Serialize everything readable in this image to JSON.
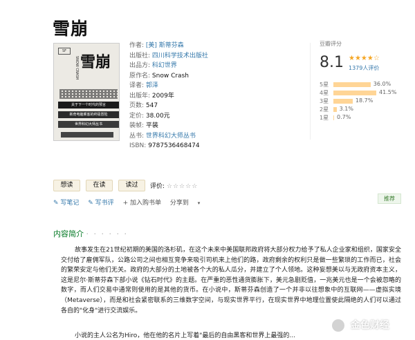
{
  "book": {
    "title": "雪崩",
    "cover": {
      "big_title": "雪崩",
      "en_title": "SNOW CRASH",
      "bands": [
        "关于下一个时代的预言",
        "新奇电脑乘客的终极冒险",
        "世界科幻大师丛书"
      ]
    },
    "info": [
      {
        "label": "作者:",
        "value": "[美] 斯蒂芬森",
        "link": true
      },
      {
        "label": "出版社:",
        "value": "四川科学技术出版社",
        "link": true
      },
      {
        "label": "出品方:",
        "value": "科幻世界",
        "link": true
      },
      {
        "label": "原作名:",
        "value": "Snow Crash",
        "link": false
      },
      {
        "label": "译者:",
        "value": "郭泽",
        "link": true
      },
      {
        "label": "出版年:",
        "value": "2009年",
        "link": false
      },
      {
        "label": "页数:",
        "value": "547",
        "link": false
      },
      {
        "label": "定价:",
        "value": "38.00元",
        "link": false
      },
      {
        "label": "装帧:",
        "value": "平装",
        "link": false
      },
      {
        "label": "丛书:",
        "value": "世界科幻大师丛书",
        "link": true
      },
      {
        "label": "ISBN:",
        "value": "9787536468474",
        "link": false
      }
    ]
  },
  "rating": {
    "title": "豆瓣评分",
    "score": "8.1",
    "stars": "★★★★☆",
    "count": "1379人评价",
    "distribution": [
      {
        "label": "5星",
        "percent": "36.0%",
        "value": 36.0
      },
      {
        "label": "4星",
        "percent": "41.5%",
        "value": 41.5
      },
      {
        "label": "3星",
        "percent": "18.7%",
        "value": 18.7
      },
      {
        "label": "2星",
        "percent": "3.1%",
        "value": 3.1
      },
      {
        "label": "1星",
        "percent": "0.7%",
        "value": 0.7
      }
    ]
  },
  "actions": {
    "want": "想读",
    "reading": "在读",
    "read": "读过",
    "rate_label": "评价:",
    "rate_stars": "☆☆☆☆☆",
    "write_note": "✎ 写笔记",
    "write_review": "✎ 写书评",
    "add_cart": "+ 加入购书单",
    "share": "分享到",
    "recommend": "推荐"
  },
  "intro": {
    "title": "内容简介",
    "dots": "· · · · · ·",
    "para1": "故事发生在21世纪初期的美国的洛杉矶，在这个未来中美国联邦政府将大部分权力给予了私人企业家和组织，国家安全交付给了雇佣军队，公路公司之间也相互竞争来吸引司机来上他们的路，政府剩余的权利只是做一些繁琐的工作而已，社会的繁荣安定与他们无关。政府的大部分的土地被各个大的私人瓜分，并建立了个人领地。这种妄想美以与无政府资本主义，这是尼尔·斯蒂芬森下部小说《钻石时代》的主题。在严重的恶性通货膨胀下，美元急剧贬值，一兆美元也是一个会被忽略的数字，而人们交易中通常则使用的是其他的货币。在小说中，斯蒂芬森创造了一个并非以往想象中的互联网——虚拟实境（Metaverse），而是和社会紧密联系的三维数字空间，与现实世界平行，在现实世界中地理位置使此隔绝的人们可以通过各自的\"化身\"进行交流娱乐。",
    "para2": "小说的主人公名为Hiro，他在他的名片上写着\"最后的自由黑客和世界上最强的..."
  },
  "watermark": "金色财经"
}
